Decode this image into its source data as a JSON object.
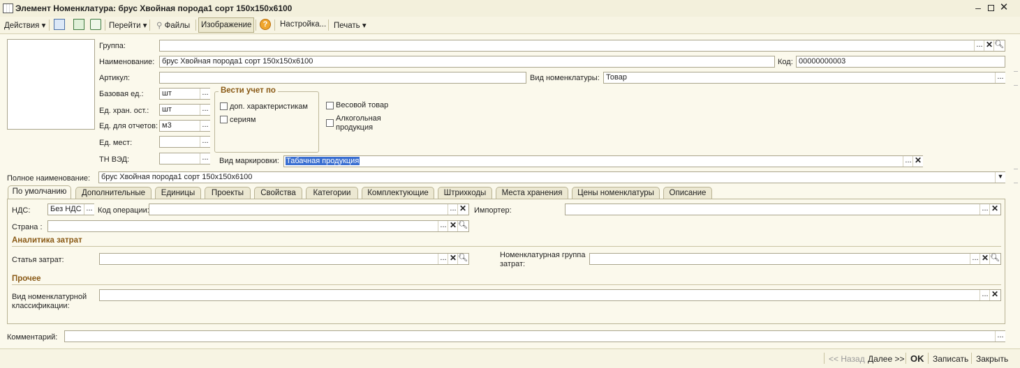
{
  "window": {
    "title": "Элемент Номенклатура: брус Хвойная порода1 сорт 150х150х6100"
  },
  "toolbar": {
    "actions": "Действия",
    "goto": "Перейти",
    "files": "Файлы",
    "image": "Изображение",
    "settings": "Настройка...",
    "print": "Печать"
  },
  "form": {
    "group_label": "Группа:",
    "group_value": "",
    "name_label": "Наименование:",
    "name_value": "брус Хвойная порода1 сорт 150х150х6100",
    "code_label": "Код:",
    "code_value": "00000000003",
    "article_label": "Артикул:",
    "article_value": "",
    "kind_label": "Вид номенклатуры:",
    "kind_value": "Товар",
    "base_unit_label": "Базовая ед.:",
    "base_unit_value": "шт",
    "storage_unit_label": "Ед. хран. ост.:",
    "storage_unit_value": "шт",
    "report_unit_label": "Ед. для отчетов:",
    "report_unit_value": "м3",
    "places_unit_label": "Ед. мест:",
    "places_unit_value": "",
    "tnved_label": "ТН ВЭД:",
    "tnved_value": "",
    "accounting_group_title": "Вести учет по",
    "cb_characteristics": "доп. характеристикам",
    "cb_series": "сериям",
    "cb_weight": "Весовой товар",
    "cb_alcohol": "Алкогольная продукция",
    "marking_label": "Вид маркировки:",
    "marking_value": "Табачная продукция",
    "full_name_label": "Полное наименование:",
    "full_name_value": "брус Хвойная порода1 сорт 150х150х6100"
  },
  "tabs": [
    "По умолчанию",
    "Дополнительные",
    "Единицы",
    "Проекты",
    "Свойства",
    "Категории",
    "Комплектующие",
    "Штрихкоды",
    "Места хранения",
    "Цены номенклатуры",
    "Описание"
  ],
  "panel": {
    "vat_label": "НДС:",
    "vat_value": "Без НДС",
    "op_code_label": "Код операции:",
    "op_code_value": "",
    "importer_label": "Импортер:",
    "importer_value": "",
    "country_label": "Страна :",
    "country_value": "",
    "cost_section": "Аналитика затрат",
    "cost_item_label": "Статья затрат:",
    "cost_item_value": "",
    "nom_group_label": "Номенклатурная группа затрат:",
    "nom_group_value": "",
    "other_section": "Прочее",
    "classif_label": "Вид номенклатурной классификации:",
    "classif_value": ""
  },
  "comment": {
    "label": "Комментарий:",
    "value": ""
  },
  "bottom": {
    "back": "<< Назад",
    "next": "Далее >>",
    "ok": "OK",
    "save": "Записать",
    "close": "Закрыть"
  },
  "colors": {
    "accent_heading": "#8a5a16",
    "background": "#fbf9ec",
    "selection": "#3a6fd1"
  }
}
